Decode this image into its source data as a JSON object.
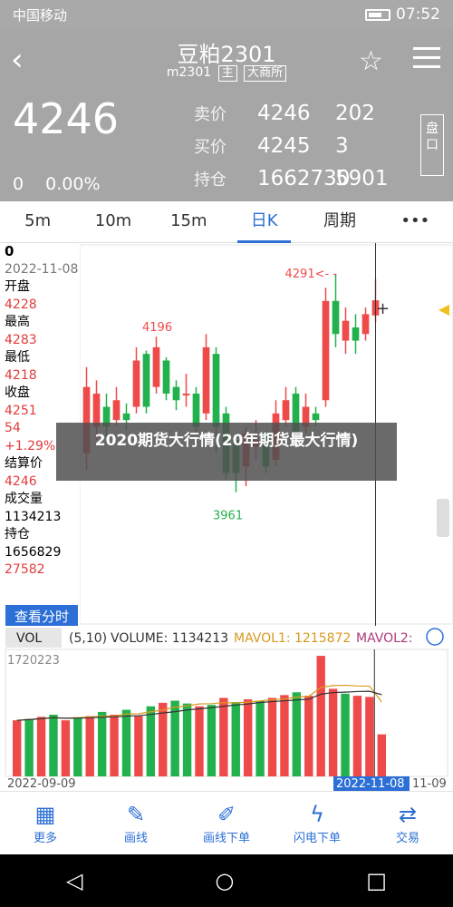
{
  "status_bar": {
    "carrier": "中国移动",
    "time": "07:52"
  },
  "header": {
    "title": "豆粕2301",
    "code": "m2301",
    "tag1": "主",
    "tag2": "大商所",
    "last_price": "4246",
    "change": "0",
    "change_pct": "0.00%",
    "sell_label": "卖价",
    "sell_price": "4246",
    "sell_vol": "202",
    "buy_label": "买价",
    "buy_price": "4245",
    "buy_vol": "3",
    "oi_label": "持仓",
    "oi_value": "1662730",
    "oi_change": "5901",
    "panel_label": "盘口"
  },
  "tabs": [
    {
      "label": "5m"
    },
    {
      "label": "10m"
    },
    {
      "label": "15m"
    },
    {
      "label": "日K",
      "active": true
    },
    {
      "label": "周期"
    },
    {
      "label": "•••"
    }
  ],
  "info": {
    "value": "0",
    "date": "2022-11-08",
    "open_label": "开盘",
    "open": "4228",
    "high_label": "最高",
    "high": "4283",
    "low_label": "最低",
    "low": "4218",
    "close_label": "收盘",
    "close": "4251",
    "change": "54",
    "change_pct": "+1.29%",
    "settle_label": "结算价",
    "settle": "4246",
    "volume_label": "成交量",
    "volume": "1134213",
    "oi_label": "持仓",
    "oi": "1656829",
    "oi_change": "27582",
    "view_button": "查看分时"
  },
  "chart_data": [
    {
      "type": "candlestick",
      "annotations": {
        "high_label": "4291<- -",
        "mid_high": "4196",
        "low_label": "3961"
      },
      "candles": [
        {
          "o": 4020,
          "c": 4120,
          "h": 4150,
          "l": 3995
        },
        {
          "o": 4060,
          "c": 4110,
          "h": 4130,
          "l": 4040
        },
        {
          "o": 4090,
          "c": 4060,
          "h": 4110,
          "l": 4045
        },
        {
          "o": 4070,
          "c": 4100,
          "h": 4120,
          "l": 4060
        },
        {
          "o": 4080,
          "c": 4070,
          "h": 4095,
          "l": 4055
        },
        {
          "o": 4090,
          "c": 4160,
          "h": 4180,
          "l": 4080
        },
        {
          "o": 4170,
          "c": 4090,
          "h": 4175,
          "l": 4080
        },
        {
          "o": 4120,
          "c": 4180,
          "h": 4196,
          "l": 4110
        },
        {
          "o": 4160,
          "c": 4110,
          "h": 4165,
          "l": 4100
        },
        {
          "o": 4120,
          "c": 4100,
          "h": 4130,
          "l": 4085
        },
        {
          "o": 4110,
          "c": 4110,
          "h": 4140,
          "l": 4090
        },
        {
          "o": 4110,
          "c": 4060,
          "h": 4120,
          "l": 4050
        },
        {
          "o": 4080,
          "c": 4180,
          "h": 4200,
          "l": 4070
        },
        {
          "o": 4170,
          "c": 4060,
          "h": 4180,
          "l": 4020
        },
        {
          "o": 4080,
          "c": 3990,
          "h": 4090,
          "l": 3980
        },
        {
          "o": 4040,
          "c": 3990,
          "h": 4050,
          "l": 3961
        },
        {
          "o": 4000,
          "c": 4050,
          "h": 4060,
          "l": 3970
        },
        {
          "o": 4030,
          "c": 4040,
          "h": 4070,
          "l": 4010
        },
        {
          "o": 4050,
          "c": 4000,
          "h": 4055,
          "l": 3990
        },
        {
          "o": 4010,
          "c": 4080,
          "h": 4100,
          "l": 4000
        },
        {
          "o": 4070,
          "c": 4100,
          "h": 4120,
          "l": 4060
        },
        {
          "o": 4110,
          "c": 4050,
          "h": 4120,
          "l": 4040
        },
        {
          "o": 4060,
          "c": 4090,
          "h": 4110,
          "l": 4050
        },
        {
          "o": 4080,
          "c": 4070,
          "h": 4090,
          "l": 4060
        },
        {
          "o": 4100,
          "c": 4250,
          "h": 4270,
          "l": 4090
        },
        {
          "o": 4250,
          "c": 4200,
          "h": 4291,
          "l": 4180
        },
        {
          "o": 4190,
          "c": 4220,
          "h": 4240,
          "l": 4170
        },
        {
          "o": 4210,
          "c": 4190,
          "h": 4230,
          "l": 4170
        },
        {
          "o": 4200,
          "c": 4230,
          "h": 4240,
          "l": 4190
        },
        {
          "o": 4228,
          "c": 4251,
          "h": 4283,
          "l": 4218
        }
      ],
      "ylim": [
        3940,
        4310
      ]
    },
    {
      "type": "bar",
      "title": "VOLUME",
      "legend": {
        "vol_label": "VOL",
        "params": "(5,10)",
        "volume": "VOLUME: 1134213",
        "mavol1": "MAVOL1: 1215872",
        "mavol2": "MAVOL2:"
      },
      "ymax_label": "1720223",
      "x_start": "2022-09-09",
      "x_end": "2022-11-08",
      "x_next": "11-09",
      "values": [
        800,
        820,
        850,
        880,
        800,
        840,
        860,
        920,
        880,
        950,
        860,
        1000,
        1050,
        1080,
        1040,
        1000,
        1020,
        1120,
        1060,
        1100,
        1080,
        1120,
        1160,
        1200,
        1150,
        1720,
        1250,
        1180,
        1150,
        1134,
        600
      ],
      "up": [
        1,
        0,
        1,
        0,
        1,
        0,
        1,
        0,
        1,
        0,
        1,
        0,
        1,
        0,
        0,
        1,
        0,
        1,
        0,
        1,
        0,
        1,
        1,
        0,
        1,
        1,
        1,
        0,
        1,
        1,
        1
      ]
    }
  ],
  "toolbar": [
    {
      "label": "更多",
      "icon": "▦"
    },
    {
      "label": "画线",
      "icon": "✎"
    },
    {
      "label": "画线下单",
      "icon": "✐"
    },
    {
      "label": "闪电下单",
      "icon": "ϟ"
    },
    {
      "label": "交易",
      "icon": "⇄"
    }
  ],
  "overlay_text": "2020期货大行情(20年期货最大行情)",
  "colors": {
    "up": "#ef4a4a",
    "down": "#23b14d",
    "accent": "#2c6fd6"
  }
}
